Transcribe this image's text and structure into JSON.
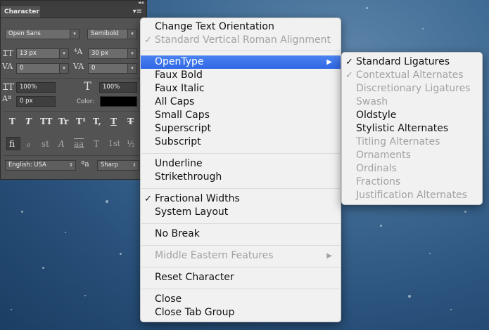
{
  "panel": {
    "tab_label": "Character",
    "panel_menu_icon": "panel-menu-icon",
    "font_family": "Open Sans",
    "font_style": "Semibold",
    "font_size": "13 px",
    "leading": "30 px",
    "kerning": "0",
    "tracking": "0",
    "vertical_scale": "100%",
    "horizontal_scale": "100%",
    "baseline_shift": "0 px",
    "color_label": "Color:",
    "color_value": "#000000",
    "language": "English: USA",
    "antialias_label": "ªa",
    "antialias": "Sharp",
    "style_buttons": [
      "T",
      "T",
      "TT",
      "Tr",
      "T¹",
      "T,",
      "T",
      "T"
    ],
    "opentype_buttons": [
      "fi",
      "ℴ",
      "st",
      "A",
      "aa",
      "T",
      "1st",
      "½"
    ]
  },
  "main_menu": {
    "items": [
      {
        "label": "Change Text Orientation",
        "enabled": true,
        "checked": false
      },
      {
        "label": "Standard Vertical Roman Alignment",
        "enabled": false,
        "checked": true
      },
      {
        "label": "OpenType",
        "enabled": true,
        "checked": false,
        "highlighted": true,
        "submenu": true
      },
      {
        "label": "Faux Bold",
        "enabled": true,
        "checked": false
      },
      {
        "label": "Faux Italic",
        "enabled": true,
        "checked": false
      },
      {
        "label": "All Caps",
        "enabled": true,
        "checked": false
      },
      {
        "label": "Small Caps",
        "enabled": true,
        "checked": false
      },
      {
        "label": "Superscript",
        "enabled": true,
        "checked": false
      },
      {
        "label": "Subscript",
        "enabled": true,
        "checked": false
      },
      {
        "label": "Underline",
        "enabled": true,
        "checked": false
      },
      {
        "label": "Strikethrough",
        "enabled": true,
        "checked": false
      },
      {
        "label": "Fractional Widths",
        "enabled": true,
        "checked": true
      },
      {
        "label": "System Layout",
        "enabled": true,
        "checked": false
      },
      {
        "label": "No Break",
        "enabled": true,
        "checked": false
      },
      {
        "label": "Middle Eastern Features",
        "enabled": false,
        "checked": false,
        "submenu": true
      },
      {
        "label": "Reset Character",
        "enabled": true,
        "checked": false
      },
      {
        "label": "Close",
        "enabled": true,
        "checked": false
      },
      {
        "label": "Close Tab Group",
        "enabled": true,
        "checked": false
      }
    ]
  },
  "opentype_menu": {
    "items": [
      {
        "label": "Standard Ligatures",
        "enabled": true,
        "checked": true
      },
      {
        "label": "Contextual Alternates",
        "enabled": false,
        "checked": true
      },
      {
        "label": "Discretionary Ligatures",
        "enabled": false,
        "checked": false
      },
      {
        "label": "Swash",
        "enabled": false,
        "checked": false
      },
      {
        "label": "Oldstyle",
        "enabled": true,
        "checked": false
      },
      {
        "label": "Stylistic Alternates",
        "enabled": true,
        "checked": false
      },
      {
        "label": "Titling Alternates",
        "enabled": false,
        "checked": false
      },
      {
        "label": "Ornaments",
        "enabled": false,
        "checked": false
      },
      {
        "label": "Ordinals",
        "enabled": false,
        "checked": false
      },
      {
        "label": "Fractions",
        "enabled": false,
        "checked": false
      },
      {
        "label": "Justification Alternates",
        "enabled": false,
        "checked": false
      }
    ]
  },
  "glyphs": {
    "check": "✓",
    "submenu_arrow": "▶",
    "dropdown": "▾",
    "collapse": "◂◂"
  }
}
